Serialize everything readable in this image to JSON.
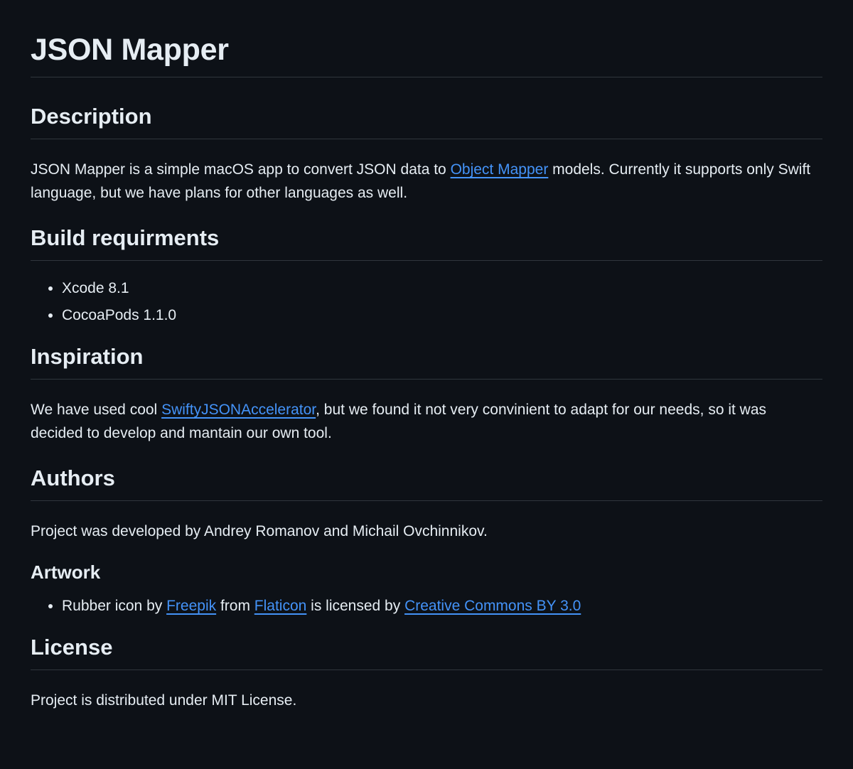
{
  "title": "JSON Mapper",
  "description": {
    "heading": "Description",
    "text_before_link": "JSON Mapper is a simple macOS app to convert JSON data to ",
    "link_text": "Object Mapper",
    "text_after_link": " models. Currently it supports only Swift language, but we have plans for other languages as well."
  },
  "build": {
    "heading": "Build requirments",
    "items": [
      "Xcode 8.1",
      "CocoaPods 1.1.0"
    ]
  },
  "inspiration": {
    "heading": "Inspiration",
    "text_before_link": "We have used cool ",
    "link_text": "SwiftyJSONAccelerator",
    "text_after_link": ", but we found it not very convinient to adapt for our needs, so it was decided to develop and mantain our own tool."
  },
  "authors": {
    "heading": "Authors",
    "text": "Project was developed by Andrey Romanov and Michail Ovchinnikov."
  },
  "artwork": {
    "heading": "Artwork",
    "item": {
      "text_1": "Rubber icon by ",
      "link_1": "Freepik",
      "text_2": " from ",
      "link_2": "Flaticon",
      "text_3": " is licensed by ",
      "link_3": "Creative Commons BY 3.0"
    }
  },
  "license": {
    "heading": "License",
    "text": "Project is distributed under MIT License."
  },
  "colors": {
    "background": "#0d1117",
    "text": "#e6edf3",
    "link": "#4493f8",
    "divider": "#30363d"
  }
}
